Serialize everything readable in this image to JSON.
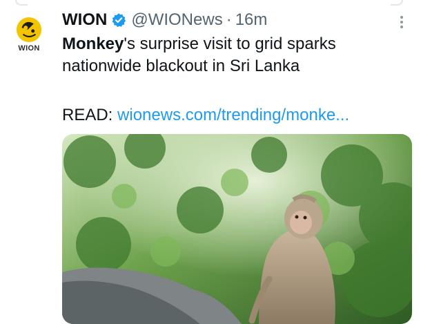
{
  "tweet": {
    "author_name": "WION",
    "handle": "@WIONews",
    "separator": "·",
    "time": "16m",
    "avatar_label": "WION",
    "text_bold": "Monkey",
    "text_rest": "'s surprise visit to grid sparks nationwide blackout in Sri Lanka",
    "read_label": "READ:",
    "link_text": "wionews.com/trending/monke...",
    "icons": {
      "verified": "verified-badge-icon",
      "more": "more-options-icon"
    },
    "colors": {
      "link": "#1d9bf0",
      "verified": "#1d9bf0",
      "secondary_text": "#536471",
      "avatar_yellow": "#f5c400"
    }
  }
}
